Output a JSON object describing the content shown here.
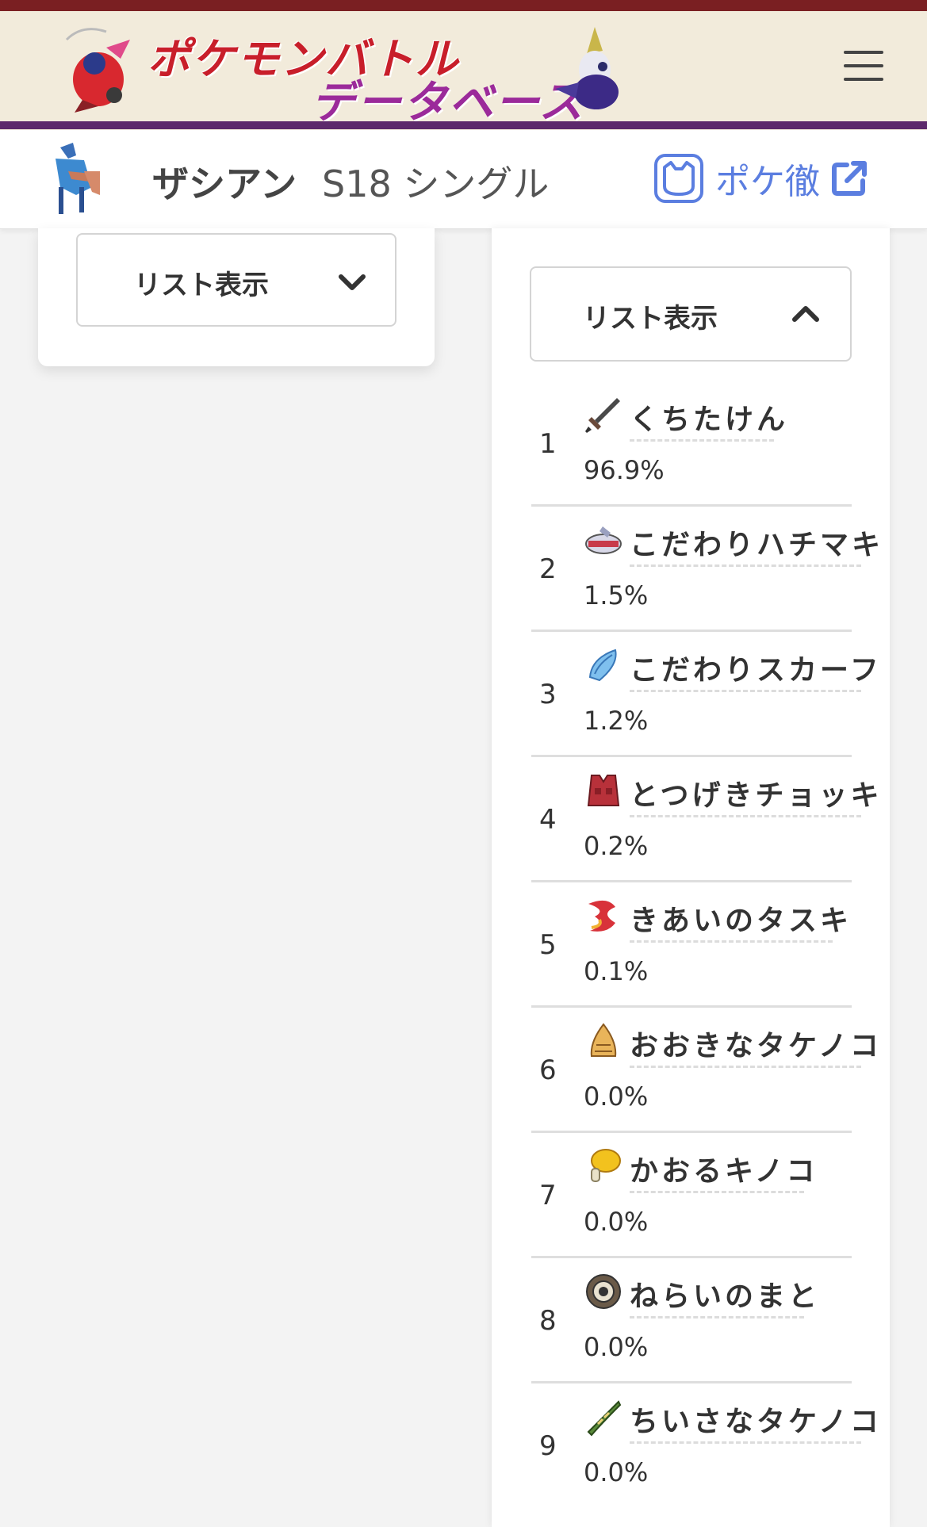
{
  "header": {
    "logo_line1": "ポケモンバトル",
    "logo_line2": "データベース",
    "menu_icon": "hamburger-menu-icon"
  },
  "titlebar": {
    "pokemon_name": "ザシアン",
    "season": "S18 シングル",
    "poketetsu_label": "ポケ徹",
    "poketetsu_icon": "pokemon-face-icon",
    "external_icon": "external-link-icon"
  },
  "left_panel": {
    "select_label": "リスト表示",
    "select_icon": "chevron-down-icon"
  },
  "right_panel": {
    "select_label": "リスト表示",
    "select_icon": "chevron-up-icon",
    "items": [
      {
        "rank": "1",
        "name": "くちたけん",
        "percent": "96.9%",
        "icon": "rusted-sword-icon"
      },
      {
        "rank": "2",
        "name": "こだわりハチマキ",
        "percent": "1.5%",
        "icon": "choice-band-icon"
      },
      {
        "rank": "3",
        "name": "こだわりスカーフ",
        "percent": "1.2%",
        "icon": "choice-scarf-icon"
      },
      {
        "rank": "4",
        "name": "とつげきチョッキ",
        "percent": "0.2%",
        "icon": "assault-vest-icon"
      },
      {
        "rank": "5",
        "name": "きあいのタスキ",
        "percent": "0.1%",
        "icon": "focus-sash-icon"
      },
      {
        "rank": "6",
        "name": "おおきなタケノコ",
        "percent": "0.0%",
        "icon": "big-bamboo-shoot-icon"
      },
      {
        "rank": "7",
        "name": "かおるキノコ",
        "percent": "0.0%",
        "icon": "balm-mushroom-icon"
      },
      {
        "rank": "8",
        "name": "ねらいのまと",
        "percent": "0.0%",
        "icon": "ring-target-icon"
      },
      {
        "rank": "9",
        "name": "ちいさなタケノコ",
        "percent": "0.0%",
        "icon": "tiny-bamboo-shoot-icon"
      }
    ]
  },
  "colors": {
    "header_bg": "#f2ebdb",
    "header_top_line": "#7a1f22",
    "header_bottom_line": "#5d2a6b",
    "logo_red": "#c81e2a",
    "logo_purple": "#9b2a9a",
    "link_blue": "#5b7ee0"
  }
}
